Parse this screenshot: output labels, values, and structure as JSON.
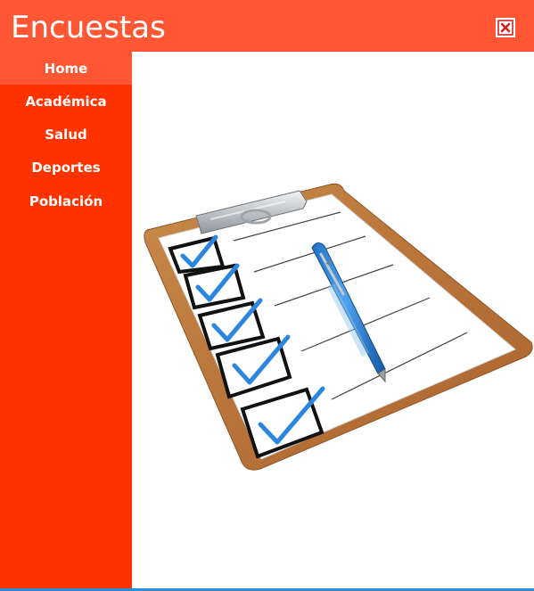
{
  "window": {
    "title": "Encuestas",
    "close_icon": "close-icon"
  },
  "sidebar": {
    "items": [
      {
        "label": "Home",
        "active": true
      },
      {
        "label": "Académica",
        "active": false
      },
      {
        "label": "Salud",
        "active": false
      },
      {
        "label": "Deportes",
        "active": false
      },
      {
        "label": "Población",
        "active": false
      }
    ]
  },
  "main": {
    "image": "clipboard-checklist-illustration"
  },
  "colors": {
    "titlebar": "#ff5733",
    "sidebar": "#ff3300",
    "active_item": "#ff5733",
    "accent_line": "#2e8bd6"
  }
}
